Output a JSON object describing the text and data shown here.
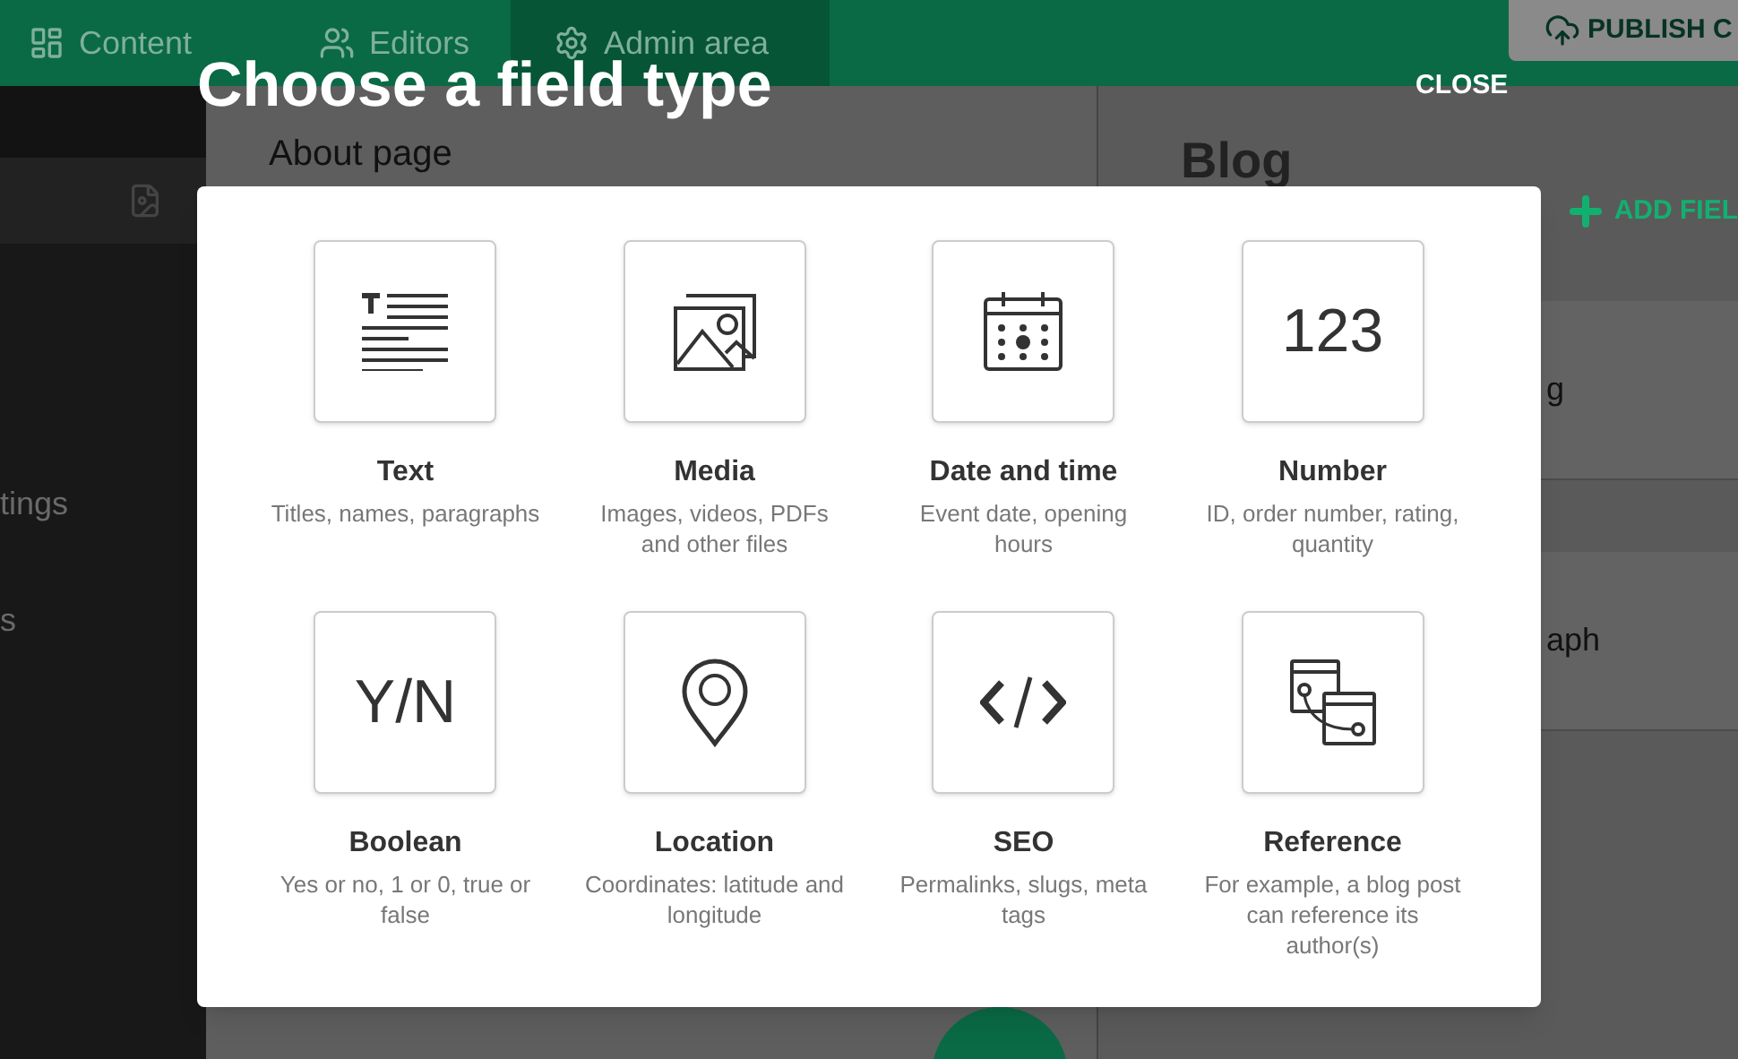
{
  "nav": {
    "tabs": [
      {
        "label": "Content",
        "selected": false
      },
      {
        "label": "Editors",
        "selected": false
      },
      {
        "label": "Admin area",
        "selected": true
      }
    ],
    "publish_button": "PUBLISH C"
  },
  "sidebar": {
    "items": [
      "tings",
      "s"
    ]
  },
  "main": {
    "heading": "About page"
  },
  "right_panel": {
    "heading": "Blog",
    "add_button": "ADD FIEL",
    "rows": [
      "g",
      "aph"
    ]
  },
  "dialog": {
    "title": "Choose a field type",
    "close": "CLOSE",
    "field_types": [
      {
        "kind": "text",
        "title": "Text",
        "description": "Titles, names, paragraphs"
      },
      {
        "kind": "media",
        "title": "Media",
        "description": "Images, videos, PDFs and other files"
      },
      {
        "kind": "calendar",
        "title": "Date and time",
        "description": "Event date, opening hours"
      },
      {
        "kind": "glyph",
        "glyph": "123",
        "title": "Number",
        "description": "ID, order number, rating, quantity"
      },
      {
        "kind": "glyph",
        "glyph": "Y/N",
        "title": "Boolean",
        "description": "Yes or no, 1 or 0, true or false"
      },
      {
        "kind": "pin",
        "title": "Location",
        "description": "Coordinates: latitude and longitude"
      },
      {
        "kind": "code",
        "title": "SEO",
        "description": "Permalinks, slugs, meta tags"
      },
      {
        "kind": "reference",
        "title": "Reference",
        "description": "For example, a blog post can reference its author(s)"
      }
    ]
  }
}
